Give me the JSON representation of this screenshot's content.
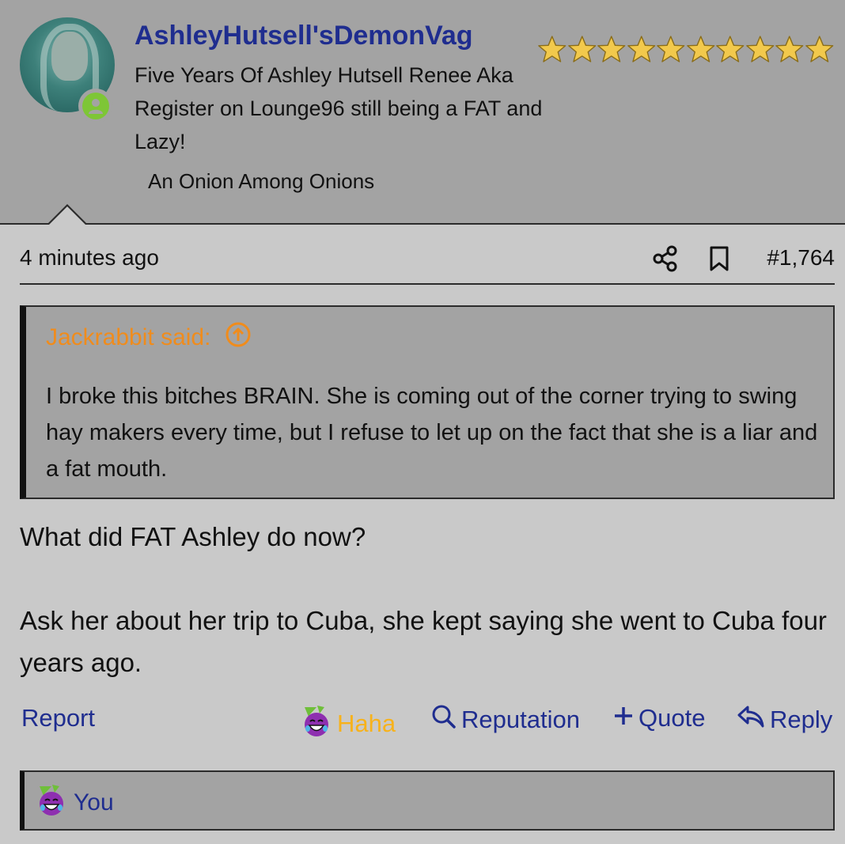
{
  "user": {
    "name": "AshleyHutsell'sDemonVag",
    "title": "Five Years Of Ashley Hutsell Renee Aka Register on Lounge96 still being a FAT and Lazy!",
    "banner": "An Onion Among Onions",
    "star_count": 10
  },
  "post": {
    "timestamp": "4 minutes ago",
    "number": "#1,764"
  },
  "quote": {
    "author": "Jackrabbit said:",
    "text": "I broke this bitches BRAIN. She is coming out of the corner trying to swing hay makers every time, but I refuse to let up on the fact that she is a liar and a fat mouth."
  },
  "message": {
    "line1": "What did FAT Ashley do now?",
    "line2": "Ask her about her trip to Cuba, she kept saying she went to Cuba four years ago."
  },
  "actions": {
    "report": "Report",
    "haha": "Haha",
    "reputation": "Reputation",
    "quote": "Quote",
    "reply": "Reply"
  },
  "reactions": {
    "label": "You"
  },
  "colors": {
    "username": "#1f2d8f",
    "quote_author": "#f08c1c",
    "haha": "#f7b21b",
    "online": "#7ec636",
    "header_bg": "#a3a3a3",
    "page_bg": "#c9c9c9"
  }
}
